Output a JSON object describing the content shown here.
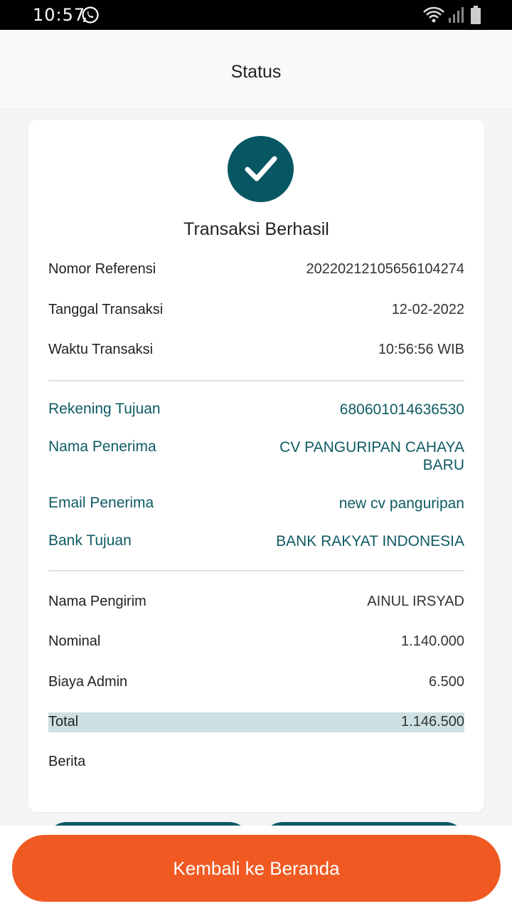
{
  "status_bar": {
    "time": "10:57",
    "icons": [
      "whatsapp-icon",
      "wifi-icon",
      "signal-icon",
      "battery-icon"
    ]
  },
  "header": {
    "title": "Status"
  },
  "result": {
    "icon": "check-circle-icon",
    "title": "Transaksi Berhasil"
  },
  "transaction": {
    "reference": {
      "label": "Nomor Referensi",
      "value": "20220212105656104274"
    },
    "date": {
      "label": "Tanggal Transaksi",
      "value": "12-02-2022"
    },
    "time": {
      "label": "Waktu Transaksi",
      "value": "10:56:56 WIB"
    }
  },
  "recipient": {
    "account": {
      "label": "Rekening Tujuan",
      "value": "680601014636530"
    },
    "name": {
      "label": "Nama Penerima",
      "value_line1": "CV PANGURIPAN CAHAYA",
      "value_line2": "BARU"
    },
    "email": {
      "label": "Email Penerima",
      "value": "new cv panguripan"
    },
    "bank": {
      "label": "Bank Tujuan",
      "value": "BANK RAKYAT INDONESIA"
    }
  },
  "payment": {
    "sender": {
      "label": "Nama Pengirim",
      "value": "AINUL IRSYAD"
    },
    "nominal": {
      "label": "Nominal",
      "value": "1.140.000"
    },
    "admin_fee": {
      "label": "Biaya Admin",
      "value": "6.500"
    },
    "total": {
      "label": "Total",
      "value": "1.146.500"
    },
    "note": {
      "label": "Berita",
      "value": ""
    }
  },
  "footer": {
    "home_button": "Kembali ke Beranda"
  },
  "colors": {
    "primary_teal": "#075763",
    "accent_orange": "#f05a22",
    "total_highlight": "#cde0e2"
  }
}
